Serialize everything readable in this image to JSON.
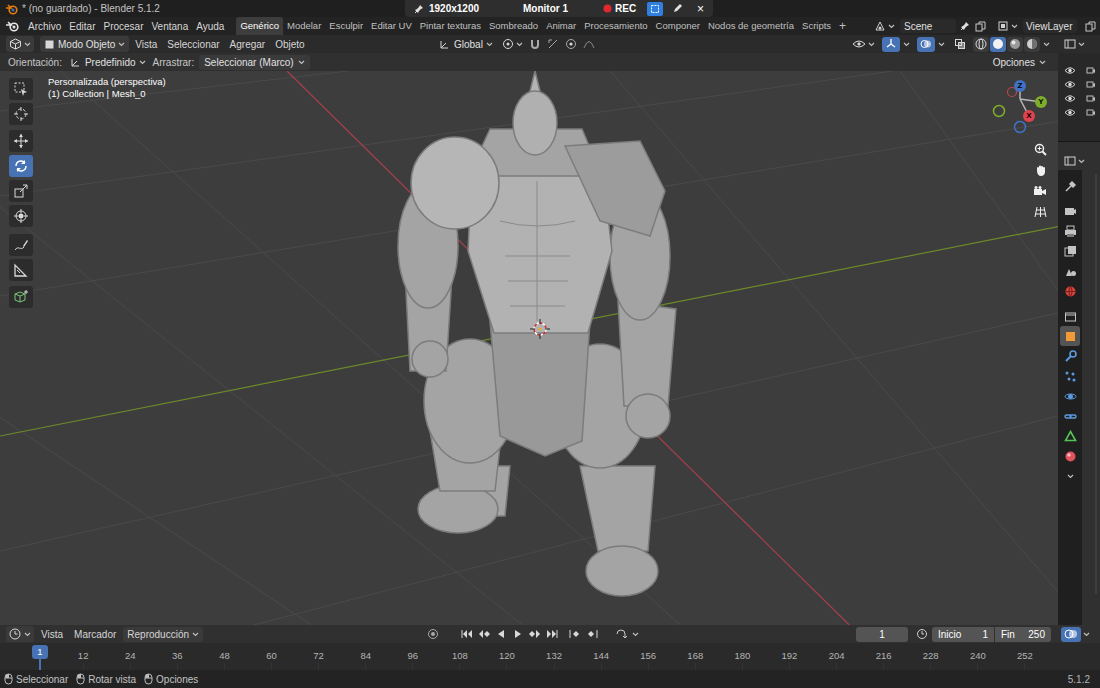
{
  "title_bar": {
    "title": "* (no guardado) - Blender 5.1.2"
  },
  "recorder": {
    "resolution": "1920x1200",
    "monitor": "Monitor 1",
    "rec": "REC",
    "close": "×",
    "buttons": [
      {
        "kind": "region",
        "selected": true
      },
      {
        "kind": "pen",
        "selected": false
      }
    ]
  },
  "menu": [
    "Archivo",
    "Editar",
    "Procesar",
    "Ventana",
    "Ayuda"
  ],
  "workspaces": [
    {
      "label": "Genérico",
      "selected": true
    },
    {
      "label": "Modelar",
      "selected": false
    },
    {
      "label": "Esculpir",
      "selected": false
    },
    {
      "label": "Editar UV",
      "selected": false
    },
    {
      "label": "Pintar texturas",
      "selected": false
    },
    {
      "label": "Sombreado",
      "selected": false
    },
    {
      "label": "Animar",
      "selected": false
    },
    {
      "label": "Procesamiento",
      "selected": false
    },
    {
      "label": "Componer",
      "selected": false
    },
    {
      "label": "Nodos de geometría",
      "selected": false
    },
    {
      "label": "Scripts",
      "selected": false
    }
  ],
  "add_workspace": "+",
  "scene": "Scene",
  "view_layer": "ViewLayer",
  "viewport_header": {
    "mode": "Modo Objeto",
    "menus": [
      "Vista",
      "Seleccionar",
      "Agregar",
      "Objeto"
    ],
    "orientation": "Global",
    "shading": [
      {
        "selected": false
      },
      {
        "selected": true
      },
      {
        "selected": false
      },
      {
        "selected": false
      }
    ],
    "gizmos_on": true,
    "overlays_on": true
  },
  "tool_settings": {
    "orientation_label": "Orientación:",
    "orientation": "Predefinido",
    "drag_label": "Arrastrar:",
    "drag": "Seleccionar (Marco)",
    "options": "Opciones"
  },
  "viewport": {
    "view_name": "Personalizada (perspectiva)",
    "collection": "(1) Collection | Mesh_0"
  },
  "gizmo": {
    "x": "X",
    "y": "Y",
    "z": "Z"
  },
  "tools": [
    {
      "kind": "select-box",
      "selected": false
    },
    {
      "kind": "cursor",
      "selected": false
    },
    {
      "kind": "move",
      "selected": false
    },
    {
      "kind": "rotate",
      "selected": true
    },
    {
      "kind": "scale",
      "selected": false
    },
    {
      "kind": "transform",
      "selected": false
    },
    {
      "kind": "annotate",
      "selected": false
    },
    {
      "kind": "measure",
      "selected": false
    },
    {
      "kind": "add-cube",
      "selected": false
    }
  ],
  "outliner": [
    {
      "visible": true
    },
    {
      "visible": true
    },
    {
      "visible": true
    },
    {
      "visible": true
    }
  ],
  "properties_tabs": [
    {
      "kind": "tool",
      "selected": false
    },
    {
      "kind": "render",
      "selected": false
    },
    {
      "kind": "output",
      "selected": false
    },
    {
      "kind": "view-layer",
      "selected": false
    },
    {
      "kind": "scene",
      "selected": false
    },
    {
      "kind": "world",
      "selected": false
    },
    {
      "kind": "collection",
      "selected": false
    },
    {
      "kind": "object",
      "selected": true
    },
    {
      "kind": "modifiers",
      "selected": false
    },
    {
      "kind": "particles",
      "selected": false
    },
    {
      "kind": "physics",
      "selected": false
    },
    {
      "kind": "constraints",
      "selected": false
    },
    {
      "kind": "data",
      "selected": false
    },
    {
      "kind": "material",
      "selected": false
    }
  ],
  "timeline": {
    "menus": [
      "Vista",
      "Marcador",
      "Reproducción"
    ],
    "current_frame": "1",
    "start_label": "Inicio",
    "start": "1",
    "end_label": "Fin",
    "end": "250",
    "playhead": "1",
    "ticks": [
      "12",
      "24",
      "36",
      "48",
      "60",
      "72",
      "84",
      "96",
      "108",
      "120",
      "132",
      "144",
      "156",
      "168",
      "180",
      "192",
      "204",
      "216",
      "228",
      "240",
      "252"
    ]
  },
  "status_bar": {
    "items": [
      "Seleccionar",
      "Rotar vista",
      "Opciones"
    ],
    "version": "5.1.2"
  }
}
